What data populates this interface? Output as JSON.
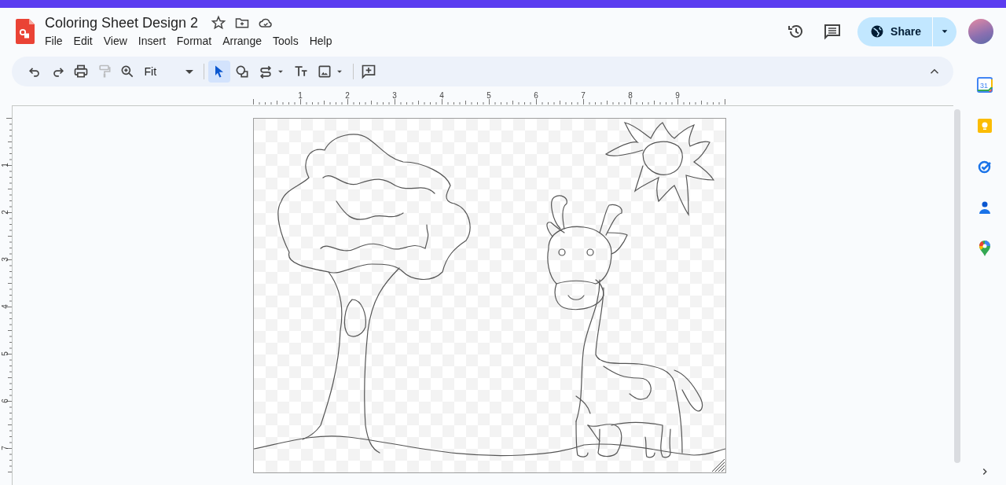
{
  "document": {
    "title": "Coloring Sheet Design 2"
  },
  "menu": [
    "File",
    "Edit",
    "View",
    "Insert",
    "Format",
    "Arrange",
    "Tools",
    "Help"
  ],
  "share": {
    "label": "Share"
  },
  "toolbar": {
    "items": [
      {
        "kind": "undo",
        "selected": false,
        "disabled": false
      },
      {
        "kind": "redo",
        "selected": false,
        "disabled": false
      },
      {
        "kind": "print",
        "selected": false,
        "disabled": false
      },
      {
        "kind": "paint-format",
        "selected": false,
        "disabled": true
      },
      {
        "kind": "zoom",
        "selected": false,
        "disabled": false
      },
      {
        "kind": "zoom-select",
        "value": "Fit"
      },
      {
        "kind": "separator"
      },
      {
        "kind": "select",
        "selected": true,
        "disabled": false
      },
      {
        "kind": "shape",
        "selected": false,
        "disabled": false
      },
      {
        "kind": "line",
        "selected": false,
        "disabled": false
      },
      {
        "kind": "caret",
        "selected": false,
        "disabled": false
      },
      {
        "kind": "text",
        "selected": false,
        "disabled": false
      },
      {
        "kind": "image",
        "selected": false,
        "disabled": false
      },
      {
        "kind": "caret",
        "selected": false,
        "disabled": false
      },
      {
        "kind": "separator"
      },
      {
        "kind": "comment",
        "selected": false,
        "disabled": false
      }
    ]
  },
  "horizontal_ruler": {
    "labels": [
      "1",
      "2",
      "3",
      "4",
      "5",
      "6",
      "7",
      "8",
      "9"
    ]
  },
  "vertical_ruler": {
    "labels": [
      "1",
      "2",
      "3",
      "4",
      "5",
      "6",
      "7"
    ]
  },
  "side_panel": {
    "apps": [
      {
        "kind": "calendar",
        "label": "31"
      },
      {
        "kind": "keep"
      },
      {
        "kind": "tasks"
      },
      {
        "kind": "contacts"
      },
      {
        "kind": "maps"
      }
    ]
  }
}
